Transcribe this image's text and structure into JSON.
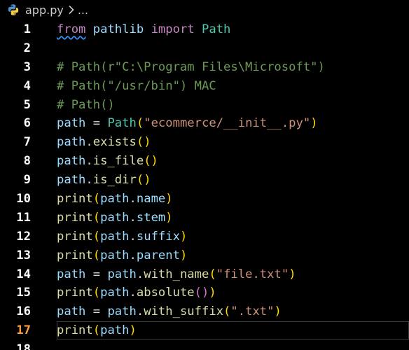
{
  "breadcrumb": {
    "file": "app.py",
    "trail": "..."
  },
  "code_lines": [
    {
      "num": "1",
      "tokens": [
        [
          "kw",
          "from"
        ],
        [
          "ws",
          " "
        ],
        [
          "id",
          "pathlib"
        ],
        [
          "ws",
          " "
        ],
        [
          "kw",
          "import"
        ],
        [
          "ws",
          " "
        ],
        [
          "cls",
          "Path"
        ]
      ]
    },
    {
      "num": "2",
      "tokens": []
    },
    {
      "num": "3",
      "tokens": [
        [
          "cmt",
          "# Path(r\"C:\\Program Files\\Microsoft\")"
        ]
      ]
    },
    {
      "num": "4",
      "tokens": [
        [
          "cmt",
          "# Path(\"/usr/bin\") MAC"
        ]
      ]
    },
    {
      "num": "5",
      "tokens": [
        [
          "cmt",
          "# Path()"
        ]
      ]
    },
    {
      "num": "6",
      "tokens": [
        [
          "id",
          "path"
        ],
        [
          "op",
          " = "
        ],
        [
          "cls",
          "Path"
        ],
        [
          "p1",
          "("
        ],
        [
          "str",
          "\"ecommerce/__init__.py\""
        ],
        [
          "p1",
          ")"
        ]
      ]
    },
    {
      "num": "7",
      "tokens": [
        [
          "id",
          "path"
        ],
        [
          "op",
          "."
        ],
        [
          "fn",
          "exists"
        ],
        [
          "p1",
          "()"
        ]
      ]
    },
    {
      "num": "8",
      "tokens": [
        [
          "id",
          "path"
        ],
        [
          "op",
          "."
        ],
        [
          "fn",
          "is_file"
        ],
        [
          "p1",
          "()"
        ]
      ]
    },
    {
      "num": "9",
      "tokens": [
        [
          "id",
          "path"
        ],
        [
          "op",
          "."
        ],
        [
          "fn",
          "is_dir"
        ],
        [
          "p1",
          "()"
        ]
      ]
    },
    {
      "num": "10",
      "tokens": [
        [
          "fn",
          "print"
        ],
        [
          "p1",
          "("
        ],
        [
          "id",
          "path"
        ],
        [
          "op",
          "."
        ],
        [
          "id",
          "name"
        ],
        [
          "p1",
          ")"
        ]
      ]
    },
    {
      "num": "11",
      "tokens": [
        [
          "fn",
          "print"
        ],
        [
          "p1",
          "("
        ],
        [
          "id",
          "path"
        ],
        [
          "op",
          "."
        ],
        [
          "id",
          "stem"
        ],
        [
          "p1",
          ")"
        ]
      ]
    },
    {
      "num": "12",
      "tokens": [
        [
          "fn",
          "print"
        ],
        [
          "p1",
          "("
        ],
        [
          "id",
          "path"
        ],
        [
          "op",
          "."
        ],
        [
          "id",
          "suffix"
        ],
        [
          "p1",
          ")"
        ]
      ]
    },
    {
      "num": "13",
      "tokens": [
        [
          "fn",
          "print"
        ],
        [
          "p1",
          "("
        ],
        [
          "id",
          "path"
        ],
        [
          "op",
          "."
        ],
        [
          "id",
          "parent"
        ],
        [
          "p1",
          ")"
        ]
      ]
    },
    {
      "num": "14",
      "tokens": [
        [
          "id",
          "path"
        ],
        [
          "op",
          " = "
        ],
        [
          "id",
          "path"
        ],
        [
          "op",
          "."
        ],
        [
          "fn",
          "with_name"
        ],
        [
          "p1",
          "("
        ],
        [
          "str",
          "\"file.txt\""
        ],
        [
          "p1",
          ")"
        ]
      ]
    },
    {
      "num": "15",
      "tokens": [
        [
          "fn",
          "print"
        ],
        [
          "p1",
          "("
        ],
        [
          "id",
          "path"
        ],
        [
          "op",
          "."
        ],
        [
          "fn",
          "absolute"
        ],
        [
          "p2",
          "()"
        ],
        [
          "p1",
          ")"
        ]
      ]
    },
    {
      "num": "16",
      "tokens": [
        [
          "id",
          "path"
        ],
        [
          "op",
          " = "
        ],
        [
          "id",
          "path"
        ],
        [
          "op",
          "."
        ],
        [
          "fn",
          "with_suffix"
        ],
        [
          "p1",
          "("
        ],
        [
          "str",
          "\".txt\""
        ],
        [
          "p1",
          ")"
        ]
      ]
    },
    {
      "num": "17",
      "tokens": [
        [
          "fn",
          "print"
        ],
        [
          "p1",
          "("
        ],
        [
          "id",
          "path"
        ],
        [
          "p1",
          ")"
        ]
      ]
    },
    {
      "num": "18",
      "tokens": []
    }
  ],
  "current_line": "17",
  "colors": {
    "background": "#000000",
    "keyword": "#c586c0",
    "identifier": "#9cdcfe",
    "class": "#4ec9b0",
    "function": "#dcdcaa",
    "string": "#ce9178",
    "comment": "#6a9955",
    "bracket_level1": "#ffd700",
    "bracket_level2": "#da70d6",
    "current_line_number": "#ff9c3c"
  },
  "icons": {
    "file_type": "python-icon",
    "separator": "chevron-right-icon"
  }
}
